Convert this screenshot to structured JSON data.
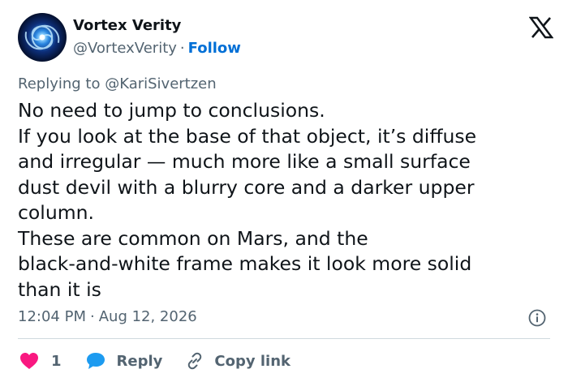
{
  "author": {
    "display_name": "Vortex Verity",
    "handle": "@VortexVerity",
    "separator": "·",
    "follow_label": "Follow"
  },
  "reply_context": "Replying to @KariSivertzen",
  "post": {
    "lines": [
      "No need to jump to conclusions.",
      "If you look at the base of that object, it’s diffuse",
      "and irregular — much more like a small surface",
      "dust devil with a blurry core and a darker upper",
      "column.",
      "These are common on Mars, and the",
      "black-and-white frame makes it look more solid",
      "than it is"
    ]
  },
  "meta": {
    "time": "12:04 PM",
    "separator": "·",
    "date": "Aug 12, 2026"
  },
  "actions": {
    "like_count": "1",
    "reply_label": "Reply",
    "copy_link_label": "Copy link"
  },
  "colors": {
    "heart": "#f91880",
    "reply_icon": "#1d9bf0",
    "follow": "#006fd6",
    "secondary_text": "#536471"
  },
  "icons": {
    "logo": "x-logo-icon",
    "info": "info-icon",
    "like": "heart-icon",
    "reply": "speech-bubble-icon",
    "copy_link": "link-icon"
  }
}
